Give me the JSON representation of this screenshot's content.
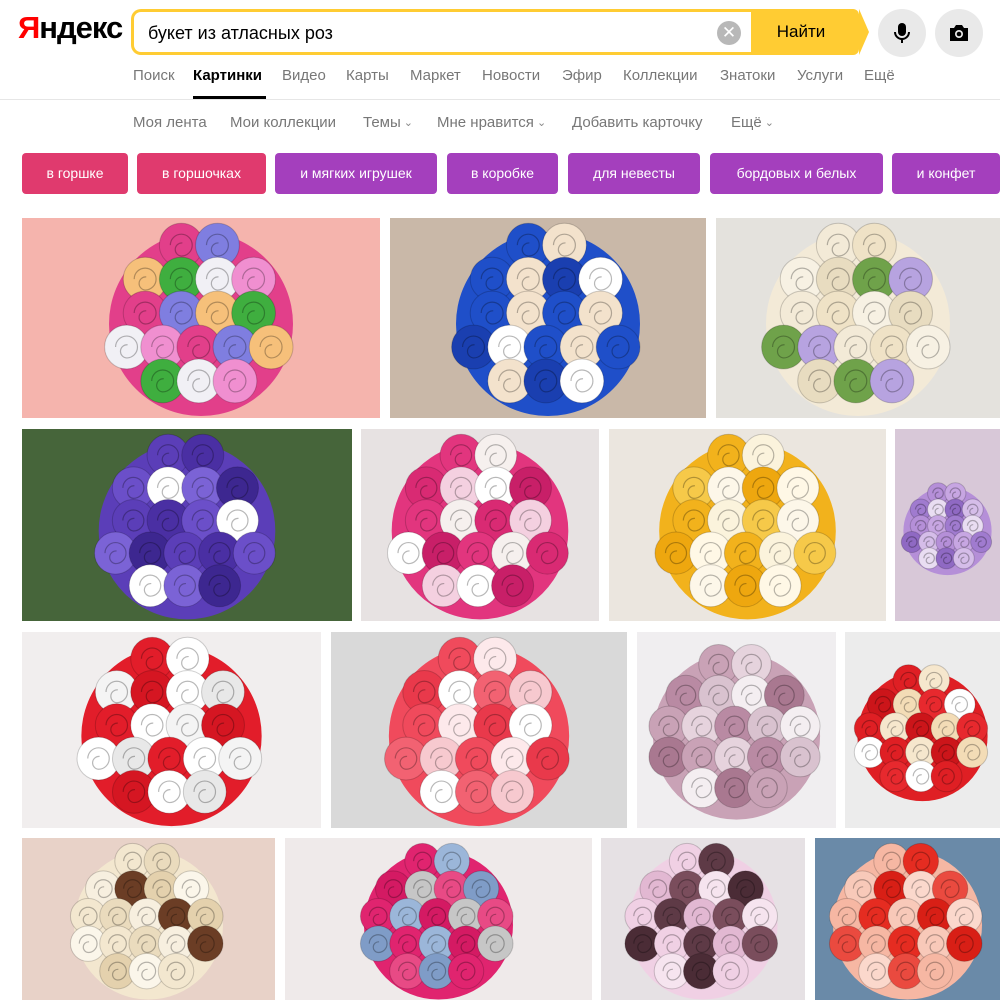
{
  "logo": {
    "first": "Я",
    "rest": "ндекс"
  },
  "search": {
    "query": "букет из атласных роз",
    "clear_glyph": "✕",
    "find_label": "Найти"
  },
  "icons": {
    "voice": "microphone-icon",
    "camera": "camera-icon",
    "clear": "clear-icon"
  },
  "nav": [
    {
      "label": "Поиск",
      "active": false
    },
    {
      "label": "Картинки",
      "active": true
    },
    {
      "label": "Видео",
      "active": false
    },
    {
      "label": "Карты",
      "active": false
    },
    {
      "label": "Маркет",
      "active": false
    },
    {
      "label": "Новости",
      "active": false
    },
    {
      "label": "Эфир",
      "active": false
    },
    {
      "label": "Коллекции",
      "active": false
    },
    {
      "label": "Знатоки",
      "active": false
    },
    {
      "label": "Услуги",
      "active": false
    },
    {
      "label": "Ещё",
      "active": false
    }
  ],
  "subnav": [
    {
      "label": "Моя лента"
    },
    {
      "label": "Мои коллекции"
    },
    {
      "label": "Темы",
      "dropdown": true
    },
    {
      "label": "Мне нравится",
      "dropdown": true
    },
    {
      "label": "Добавить карточку"
    },
    {
      "label": "Ещё",
      "dropdown": true
    }
  ],
  "tags": [
    {
      "label": "в горшке",
      "color": "#e03a6e"
    },
    {
      "label": "в горшочках",
      "color": "#e03a6e"
    },
    {
      "label": "и мягких игрушек",
      "color": "#a43fbd"
    },
    {
      "label": "в коробке",
      "color": "#a43fbd"
    },
    {
      "label": "для невесты",
      "color": "#a43fbd"
    },
    {
      "label": "бордовых и белых",
      "color": "#a43fbd"
    },
    {
      "label": "и конфет",
      "color": "#a43fbd"
    }
  ],
  "results": [
    {
      "bg": "#f5b4ad",
      "roses": [
        "#e23f8a",
        "#7f7ee0",
        "#f6c07a",
        "#3fae3f",
        "#f1f0f5",
        "#f08fd0"
      ]
    },
    {
      "bg": "#c9b8a8",
      "roses": [
        "#1f4fc9",
        "#f3e2cc",
        "#1f4fc9",
        "#f3e2cc",
        "#1a3fb0",
        "#ffffff"
      ]
    },
    {
      "bg": "#e4e2dd",
      "roses": [
        "#f3ead7",
        "#efe2c6",
        "#f7f1e3",
        "#e8dcc0",
        "#6fa24a",
        "#b7a3e0"
      ]
    },
    {
      "bg": "#46653a",
      "roses": [
        "#5b3eb8",
        "#4a2fa3",
        "#6b4fc9",
        "#ffffff",
        "#7b63d6",
        "#3d2790"
      ]
    },
    {
      "bg": "#e7e2e2",
      "roses": [
        "#e2357e",
        "#f6f0ee",
        "#d92a73",
        "#f4d0e0",
        "#ffffff",
        "#c81f68"
      ]
    },
    {
      "bg": "#ebe6df",
      "roses": [
        "#f2b21c",
        "#fbf3dc",
        "#f6c949",
        "#fdf7e9",
        "#eea70f",
        "#fff8e6"
      ]
    },
    {
      "bg": "#d8c8d8",
      "roses": [
        "#b58fd8",
        "#c7a6e2",
        "#a07bcf",
        "#e9ddf2",
        "#8f69c3",
        "#d5bde9"
      ]
    },
    {
      "bg": "#f1eeee",
      "roses": [
        "#e21d2a",
        "#ffffff",
        "#f4f4f4",
        "#d51622",
        "#ffffff",
        "#e8e8e8"
      ]
    },
    {
      "bg": "#d9d9d9",
      "roses": [
        "#f04a5c",
        "#fde9eb",
        "#e9394b",
        "#ffffff",
        "#f26272",
        "#f7c9cf"
      ]
    },
    {
      "bg": "#f0eef0",
      "roses": [
        "#c9a2b6",
        "#e6d3dd",
        "#b98aa3",
        "#d9c2cf",
        "#f4eef1",
        "#a97890"
      ]
    },
    {
      "bg": "#ececec",
      "roses": [
        "#df1f24",
        "#f6e7cd",
        "#cc151a",
        "#f3dcb6",
        "#e7292e",
        "#ffffff"
      ]
    },
    {
      "bg": "#e8d2c8",
      "roses": [
        "#f3e7cf",
        "#eadbbd",
        "#f7efdf",
        "#6b3d25",
        "#e4d1ad",
        "#fbf6ea"
      ]
    },
    {
      "bg": "#efeaea",
      "roses": [
        "#e0246f",
        "#9bb6d9",
        "#d41a63",
        "#c6c6c6",
        "#e84a85",
        "#7f9cc7"
      ]
    },
    {
      "bg": "#e6e1e4",
      "roses": [
        "#f0d0e4",
        "#5e3a46",
        "#e2b8d2",
        "#7a4d5c",
        "#f6e4ef",
        "#4b2c36"
      ]
    },
    {
      "bg": "#6a8aa8",
      "roses": [
        "#f6b7a3",
        "#e52c21",
        "#f8c9b9",
        "#d81f16",
        "#fbd8cc",
        "#ea4a3f"
      ]
    }
  ]
}
